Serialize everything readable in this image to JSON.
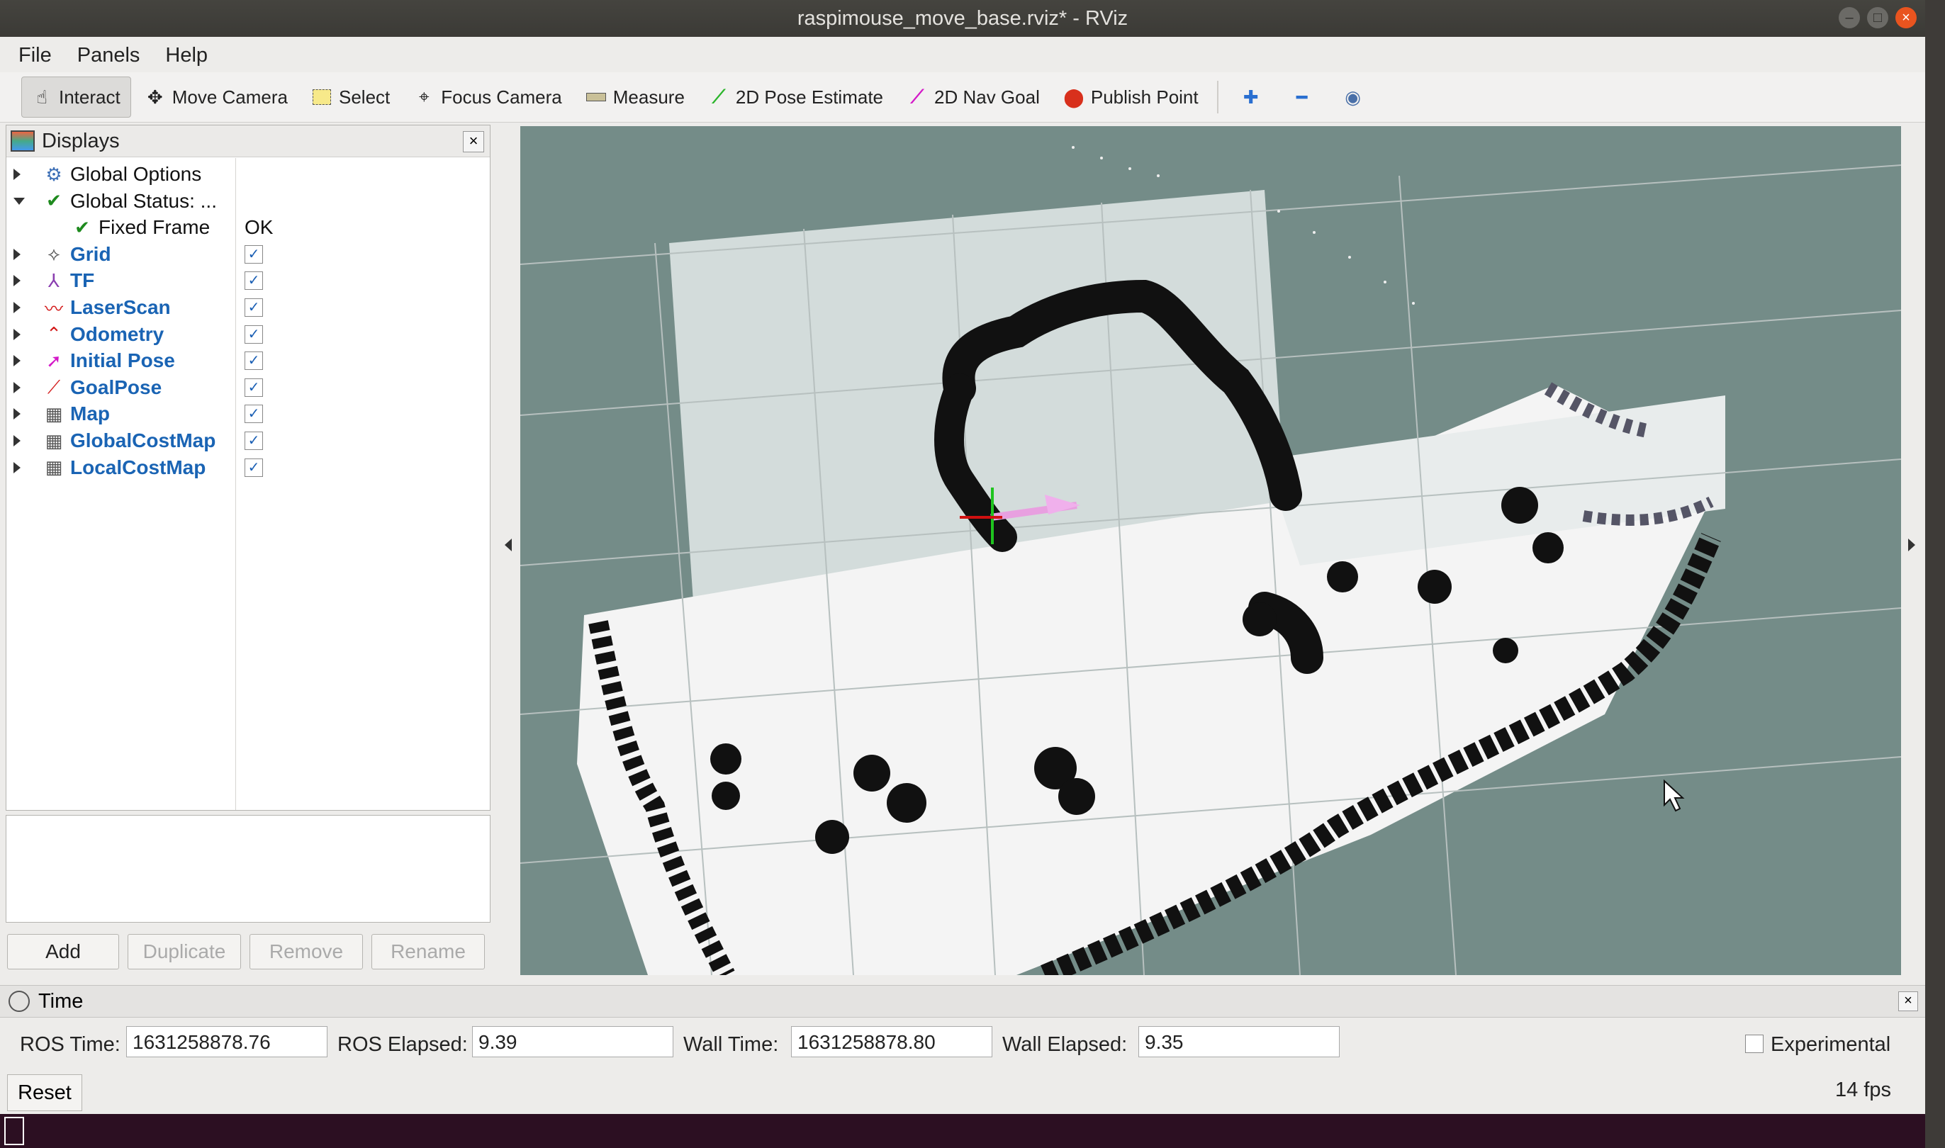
{
  "window": {
    "title": "raspimouse_move_base.rviz* - RViz"
  },
  "menu": [
    "File",
    "Panels",
    "Help"
  ],
  "toolbar": {
    "tools": [
      {
        "label": "Interact",
        "icon": "hand-icon",
        "active": true
      },
      {
        "label": "Move Camera",
        "icon": "move-camera-icon"
      },
      {
        "label": "Select",
        "icon": "select-icon"
      },
      {
        "label": "Focus Camera",
        "icon": "focus-camera-icon"
      },
      {
        "label": "Measure",
        "icon": "ruler-icon"
      },
      {
        "label": "2D Pose Estimate",
        "icon": "pose-estimate-arrow-icon"
      },
      {
        "label": "2D Nav Goal",
        "icon": "nav-goal-arrow-icon"
      },
      {
        "label": "Publish Point",
        "icon": "map-pin-icon"
      }
    ]
  },
  "displays": {
    "title": "Displays",
    "items": [
      {
        "label": "Global Options",
        "icon": "gear-icon",
        "expand": "right",
        "value": "",
        "checkbox": false
      },
      {
        "label": "Global Status: ...",
        "icon": "check-icon",
        "expand": "down",
        "value": "",
        "checkbox": false
      },
      {
        "label": "Fixed Frame",
        "icon": "check-icon",
        "expand": "none",
        "value": "OK",
        "checkbox": false
      },
      {
        "label": "Grid",
        "icon": "grid-icon",
        "expand": "right",
        "value": "",
        "checkbox": true
      },
      {
        "label": "TF",
        "icon": "tf-axes-icon",
        "expand": "right",
        "value": "",
        "checkbox": true
      },
      {
        "label": "LaserScan",
        "icon": "laserscan-icon",
        "expand": "right",
        "value": "",
        "checkbox": true
      },
      {
        "label": "Odometry",
        "icon": "odometry-icon",
        "expand": "right",
        "value": "",
        "checkbox": true
      },
      {
        "label": "Initial Pose",
        "icon": "pose-icon",
        "expand": "right",
        "value": "",
        "checkbox": true
      },
      {
        "label": "GoalPose",
        "icon": "goal-pose-icon",
        "expand": "right",
        "value": "",
        "checkbox": true
      },
      {
        "label": "Map",
        "icon": "map-icon",
        "expand": "right",
        "value": "",
        "checkbox": true
      },
      {
        "label": "GlobalCostMap",
        "icon": "map-icon",
        "expand": "right",
        "value": "",
        "checkbox": true
      },
      {
        "label": "LocalCostMap",
        "icon": "map-icon",
        "expand": "right",
        "value": "",
        "checkbox": true
      }
    ],
    "buttons": {
      "add": "Add",
      "duplicate": "Duplicate",
      "remove": "Remove",
      "rename": "Rename"
    }
  },
  "time": {
    "title": "Time",
    "ros_time_label": "ROS Time:",
    "ros_time": "1631258878.76",
    "ros_elapsed_label": "ROS Elapsed:",
    "ros_elapsed": "9.39",
    "wall_time_label": "Wall Time:",
    "wall_time": "1631258878.80",
    "wall_elapsed_label": "Wall Elapsed:",
    "wall_elapsed": "9.35",
    "experimental_label": "Experimental",
    "reset_label": "Reset",
    "fps": "14 fps"
  },
  "colors": {
    "link_blue": "#1a64b4",
    "viewport_bg": "#748c88",
    "close_orange": "#e9541f"
  }
}
